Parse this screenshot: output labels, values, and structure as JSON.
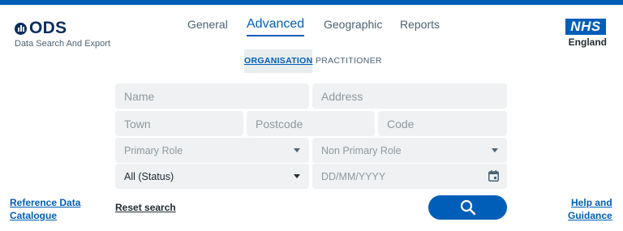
{
  "header": {
    "logo_text": "ODS",
    "logo_subtitle": "Data Search And Export",
    "nhs_logo_text": "NHS",
    "nhs_logo_subtitle": "England"
  },
  "nav": {
    "items": [
      {
        "label": "General",
        "active": false
      },
      {
        "label": "Advanced",
        "active": true
      },
      {
        "label": "Geographic",
        "active": false
      },
      {
        "label": "Reports",
        "active": false
      }
    ]
  },
  "subtabs": [
    {
      "label": "ORGANISATION",
      "active": true
    },
    {
      "label": "PRACTITIONER",
      "active": false
    }
  ],
  "form": {
    "name_placeholder": "Name",
    "address_placeholder": "Address",
    "town_placeholder": "Town",
    "postcode_placeholder": "Postcode",
    "code_placeholder": "Code",
    "primary_role": "Primary Role",
    "non_primary_role": "Non Primary Role",
    "status": "All (Status)",
    "date_placeholder": "DD/MM/YYYY"
  },
  "footer": {
    "reference_link_line1": "Reference Data",
    "reference_link_line2": "Catalogue",
    "reset_label": "Reset search",
    "help_link_line1": "Help and",
    "help_link_line2": "Guidance"
  },
  "icons": {
    "logo": "bar-chart-icon",
    "search": "search-icon",
    "dropdown": "chevron-down-icon",
    "calendar": "calendar-icon"
  },
  "colors": {
    "brand_blue": "#005eb8",
    "field_bg": "#eff1f2",
    "text_dark": "#212b32",
    "text_muted": "#8f999f"
  }
}
